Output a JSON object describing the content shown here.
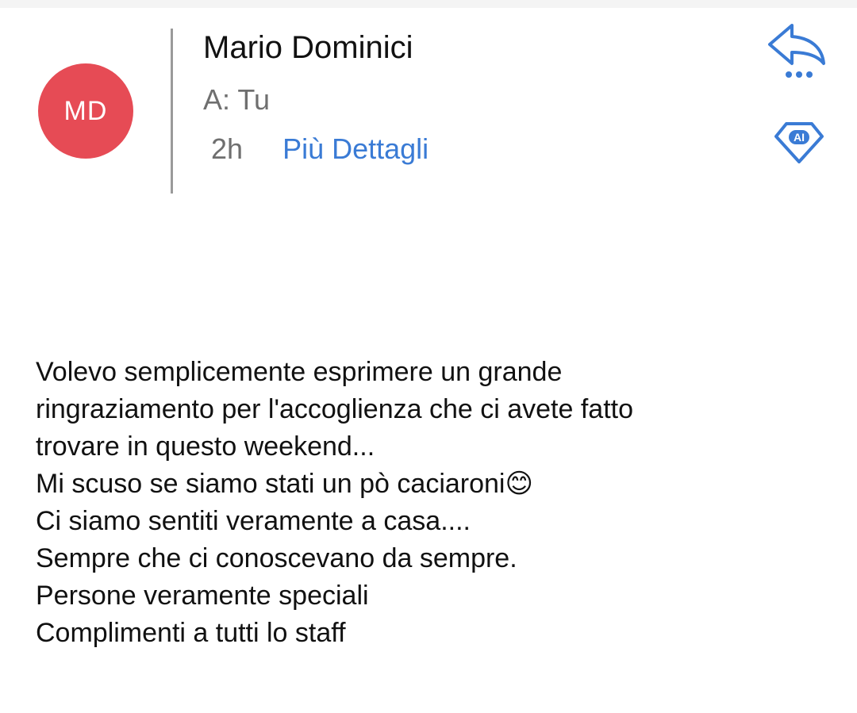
{
  "email": {
    "sender": {
      "initials": "MD",
      "name": "Mario Dominici",
      "avatar_color": "#e64b55"
    },
    "recipient_line": "A: Tu",
    "time": "2h",
    "details_link": "Più Dettagli",
    "actions": {
      "reply_icon": "reply-icon",
      "more_icon": "more-dots-icon",
      "ai_icon": "ai-diamond-icon",
      "accent_color": "#3a7bd5"
    },
    "body_lines": [
      "Volevo semplicemente esprimere un grande",
      "ringraziamento per l'accoglienza che ci avete fatto",
      "trovare in questo weekend...",
      "Mi scuso se siamo stati un pò caciaroni😊",
      "Ci siamo sentiti veramente a casa....",
      "Sempre che ci conoscevano da sempre.",
      "Persone veramente speciali",
      "Complimenti a tutti lo staff"
    ]
  }
}
